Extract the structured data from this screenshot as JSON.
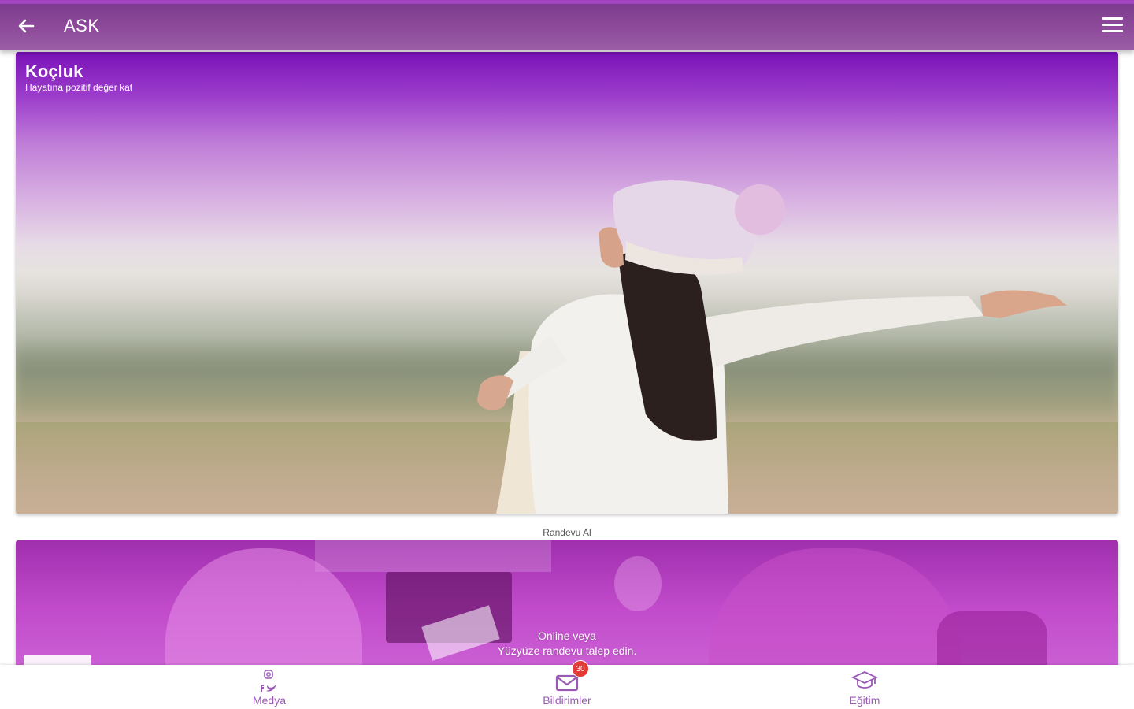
{
  "header": {
    "title": "ASK",
    "back_icon": "arrow-left-icon",
    "menu_icon": "hamburger-menu-icon"
  },
  "hero": {
    "title": "Koçluk",
    "subtitle": "Hayatına pozitif değer kat"
  },
  "section_caption": "Randevu Al",
  "appointment_card": {
    "line1": "Online veya",
    "line2": "Yüzyüze randevu talep edin."
  },
  "bottom_nav": {
    "items": [
      {
        "label": "Medya",
        "icon": "social-media-icon"
      },
      {
        "label": "Bildirimler",
        "icon": "envelope-icon",
        "badge": "30"
      },
      {
        "label": "Eğitim",
        "icon": "graduation-cap-icon"
      }
    ]
  },
  "colors": {
    "primary": "#8e4a9a",
    "accent_purple": "#9b59b6",
    "badge_red": "#e53935"
  }
}
